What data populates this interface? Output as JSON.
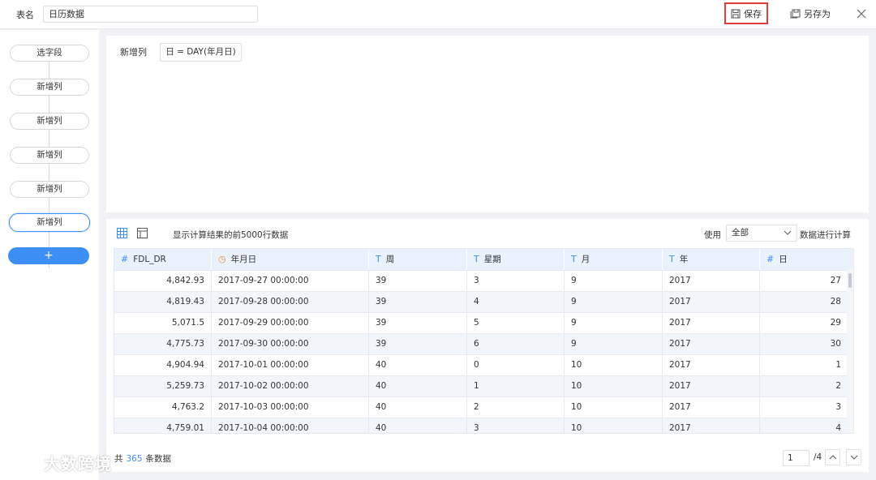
{
  "header": {
    "table_name_label": "表名",
    "table_name_value": "日历数据",
    "save_label": "保存",
    "save_as_label": "另存为"
  },
  "sidebar": {
    "steps": [
      {
        "label": "选字段"
      },
      {
        "label": "新增列"
      },
      {
        "label": "新增列"
      },
      {
        "label": "新增列"
      },
      {
        "label": "新增列"
      },
      {
        "label": "新增列"
      }
    ],
    "add_label": "+"
  },
  "formula": {
    "label": "新增列",
    "expression": "日 = DAY(年月日)"
  },
  "data_panel": {
    "caption": "显示计算结果的前5000行数据",
    "use_label": "使用",
    "use_value": "全部",
    "use_suffix": "数据进行计算",
    "columns": [
      {
        "name": "FDL_DR",
        "type": "#"
      },
      {
        "name": "年月日",
        "type": "time"
      },
      {
        "name": "周",
        "type": "T"
      },
      {
        "name": "星期",
        "type": "T"
      },
      {
        "name": "月",
        "type": "T"
      },
      {
        "name": "年",
        "type": "T"
      },
      {
        "name": "日",
        "type": "#"
      }
    ],
    "rows": [
      [
        "4,842.93",
        "2017-09-27 00:00:00",
        "39",
        "3",
        "9",
        "2017",
        "27"
      ],
      [
        "4,819.43",
        "2017-09-28 00:00:00",
        "39",
        "4",
        "9",
        "2017",
        "28"
      ],
      [
        "5,071.5",
        "2017-09-29 00:00:00",
        "39",
        "5",
        "9",
        "2017",
        "29"
      ],
      [
        "4,775.73",
        "2017-09-30 00:00:00",
        "39",
        "6",
        "9",
        "2017",
        "30"
      ],
      [
        "4,904.94",
        "2017-10-01 00:00:00",
        "40",
        "0",
        "10",
        "2017",
        "1"
      ],
      [
        "5,259.73",
        "2017-10-02 00:00:00",
        "40",
        "1",
        "10",
        "2017",
        "2"
      ],
      [
        "4,763.2",
        "2017-10-03 00:00:00",
        "40",
        "2",
        "10",
        "2017",
        "3"
      ],
      [
        "4,759.01",
        "2017-10-04 00:00:00",
        "40",
        "3",
        "10",
        "2017",
        "4"
      ]
    ],
    "total_prefix": "共",
    "total_count": "365",
    "total_suffix": "条数据",
    "page_current": "1",
    "page_total": "/4"
  },
  "watermark": {
    "text": "大数跨境"
  },
  "colors": {
    "accent": "#3d8ff5",
    "save_highlight": "#e03c3c",
    "header_bg": "#e9f2fd",
    "alt_row_bg": "#f1f6fd"
  }
}
